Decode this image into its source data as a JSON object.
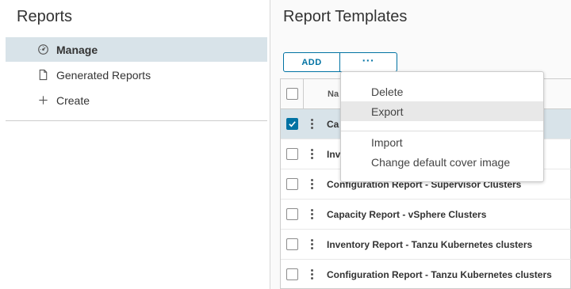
{
  "sidebar": {
    "title": "Reports",
    "items": [
      {
        "label": "Manage",
        "icon": "dashboard-gauge-icon",
        "active": true
      },
      {
        "label": "Generated Reports",
        "icon": "document-icon",
        "active": false
      },
      {
        "label": "Create",
        "icon": "plus-icon",
        "active": false
      }
    ]
  },
  "main": {
    "title": "Report Templates",
    "toolbar": {
      "add_label": "ADD",
      "more_label": "···"
    },
    "grid": {
      "header": {
        "name": "Na"
      },
      "rows": [
        {
          "name": "Ca",
          "checked": true
        },
        {
          "name": "Inv",
          "checked": false
        },
        {
          "name": "Configuration Report - Supervisor Clusters",
          "checked": false
        },
        {
          "name": "Capacity Report - vSphere Clusters",
          "checked": false
        },
        {
          "name": "Inventory Report - Tanzu Kubernetes clusters",
          "checked": false
        },
        {
          "name": "Configuration Report - Tanzu Kubernetes clusters",
          "checked": false
        }
      ]
    },
    "menu": {
      "items": [
        "Delete",
        "Export",
        "Import",
        "Change default cover image"
      ],
      "hovered": "Export"
    }
  },
  "colors": {
    "accent": "#0072a3",
    "selected_row": "#d8e3e9",
    "menu_hover": "#e8e8e8"
  }
}
